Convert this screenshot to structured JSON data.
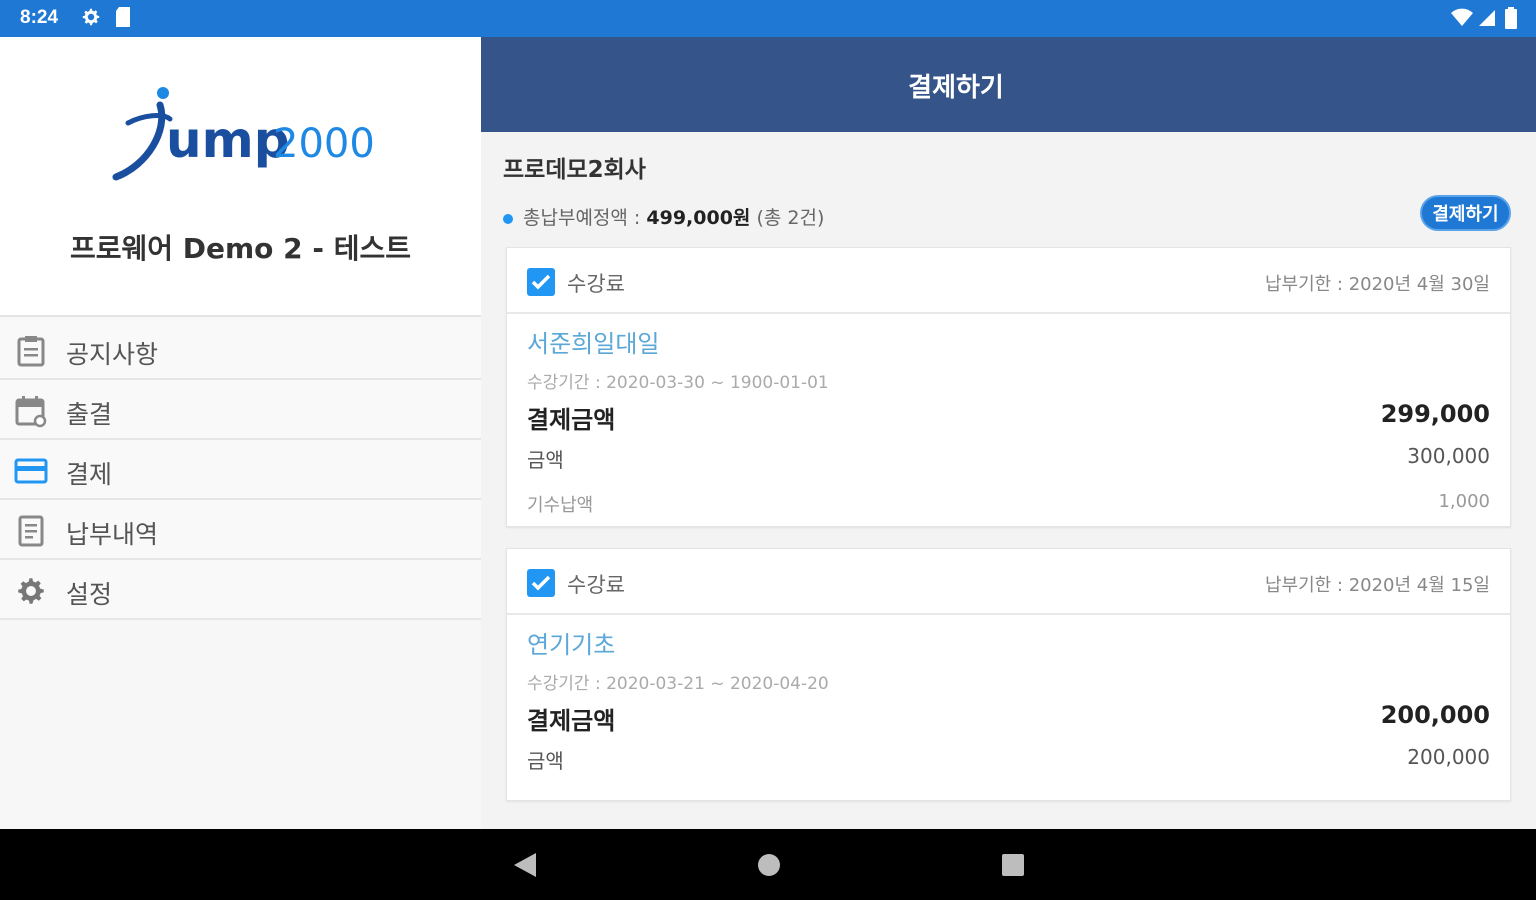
{
  "status_bar": {
    "time": "8:24",
    "icons": [
      "gear-icon",
      "sd-card-icon",
      "wifi-icon",
      "signal-icon",
      "battery-icon"
    ]
  },
  "drawer": {
    "logo_text": "jump2000",
    "company_name": "프로웨어 Demo 2 - 테스트",
    "menu": [
      {
        "label": "공지사항",
        "icon": "notice-icon"
      },
      {
        "label": "출결",
        "icon": "calendar-icon"
      },
      {
        "label": "결제",
        "icon": "card-icon",
        "active": true
      },
      {
        "label": "납부내역",
        "icon": "receipt-icon"
      },
      {
        "label": "설정",
        "icon": "gear-icon"
      }
    ]
  },
  "main": {
    "title": "결제하기",
    "company": "프로데모2회사",
    "summary": {
      "label": "총납부예정액 : ",
      "amount": "499,000원",
      "count": " (총 2건)"
    },
    "pay_button": "결제하기",
    "bills": [
      {
        "checked": true,
        "type": "수강료",
        "due": "납부기한 : 2020년 4월 30일",
        "class_name": "서준희일대일",
        "period": "수강기간 : 2020-03-30 ~ 1900-01-01",
        "pay_label": "결제금액",
        "pay_value": "299,000",
        "amount_label": "금액",
        "amount_value": "300,000",
        "misc_label": "기수납액",
        "misc_value": "1,000"
      },
      {
        "checked": true,
        "type": "수강료",
        "due": "납부기한 : 2020년 4월 15일",
        "class_name": "연기기초",
        "period": "수강기간 : 2020-03-21 ~ 2020-04-20",
        "pay_label": "결제금액",
        "pay_value": "200,000",
        "amount_label": "금액",
        "amount_value": "200,000"
      }
    ]
  },
  "colors": {
    "status_bar": "#1e78d4",
    "app_bar": "#35558a",
    "accent": "#2196f3",
    "class_link": "#5aa7d8"
  }
}
